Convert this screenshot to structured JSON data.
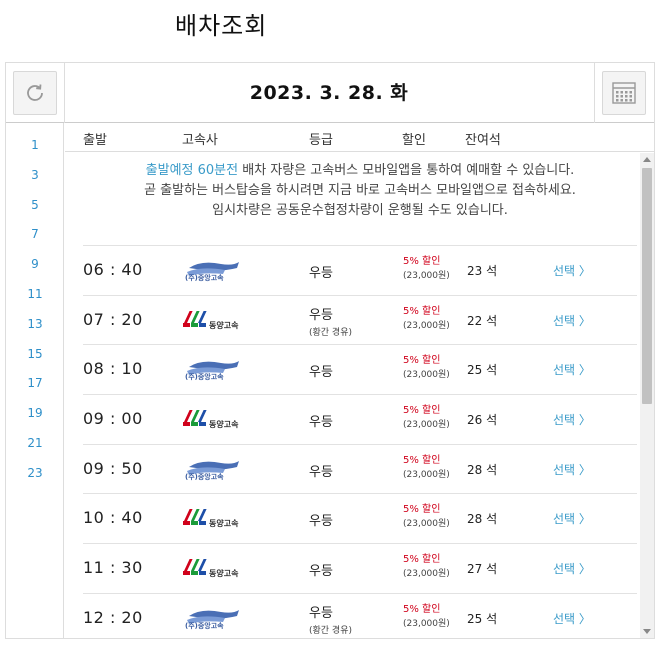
{
  "page": {
    "title": "배차조회"
  },
  "toolbar": {
    "date_label": "2023. 3. 28. 화",
    "refresh_icon": "refresh-icon",
    "calendar_icon": "calendar-icon"
  },
  "hours": [
    "1",
    "3",
    "5",
    "7",
    "9",
    "11",
    "13",
    "15",
    "17",
    "19",
    "21",
    "23"
  ],
  "columns": {
    "departure": "출발",
    "company": "고속사",
    "grade": "등급",
    "discount": "할인",
    "seats": "잔여석"
  },
  "notice": {
    "highlight": "출발예정 60분전",
    "line1_rest": " 배차 자량은 고속버스 모바일앱을 통하여 예매할 수 있습니다.",
    "line2": "곧 출발하는 버스탑승을 하시려면 지금 바로 고속버스 모바일앱으로 접속하세요.",
    "line3": "임시차량은 공동운수협정차량이 운행될 수도 있습니다."
  },
  "rows": [
    {
      "time": "06 : 40",
      "company": "(주)중앙고속",
      "company_logo": "jungang",
      "grade": "우등",
      "grade_sub": "",
      "discount": "5% 할인",
      "price": "(23,000원)",
      "seats": "23 석",
      "select": "선택 〉"
    },
    {
      "time": "07 : 20",
      "company": "동양고속",
      "company_logo": "dongyang",
      "grade": "우등",
      "grade_sub": "(황간 경유)",
      "discount": "5% 할인",
      "price": "(23,000원)",
      "seats": "22 석",
      "select": "선택 〉"
    },
    {
      "time": "08 : 10",
      "company": "(주)중앙고속",
      "company_logo": "jungang",
      "grade": "우등",
      "grade_sub": "",
      "discount": "5% 할인",
      "price": "(23,000원)",
      "seats": "25 석",
      "select": "선택 〉"
    },
    {
      "time": "09 : 00",
      "company": "동양고속",
      "company_logo": "dongyang",
      "grade": "우등",
      "grade_sub": "",
      "discount": "5% 할인",
      "price": "(23,000원)",
      "seats": "26 석",
      "select": "선택 〉"
    },
    {
      "time": "09 : 50",
      "company": "(주)중앙고속",
      "company_logo": "jungang",
      "grade": "우등",
      "grade_sub": "",
      "discount": "5% 할인",
      "price": "(23,000원)",
      "seats": "28 석",
      "select": "선택 〉"
    },
    {
      "time": "10 : 40",
      "company": "동양고속",
      "company_logo": "dongyang",
      "grade": "우등",
      "grade_sub": "",
      "discount": "5% 할인",
      "price": "(23,000원)",
      "seats": "28 석",
      "select": "선택 〉"
    },
    {
      "time": "11 : 30",
      "company": "동양고속",
      "company_logo": "dongyang",
      "grade": "우등",
      "grade_sub": "",
      "discount": "5% 할인",
      "price": "(23,000원)",
      "seats": "27 석",
      "select": "선택 〉"
    },
    {
      "time": "12 : 20",
      "company": "(주)중앙고속",
      "company_logo": "jungang",
      "grade": "우등",
      "grade_sub": "(황간 경유)",
      "discount": "5% 할인",
      "price": "(23,000원)",
      "seats": "25 석",
      "select": "선택 〉"
    }
  ],
  "colors": {
    "accent": "#3a9bc9",
    "discount": "#d0021b",
    "border": "#dddddd"
  }
}
